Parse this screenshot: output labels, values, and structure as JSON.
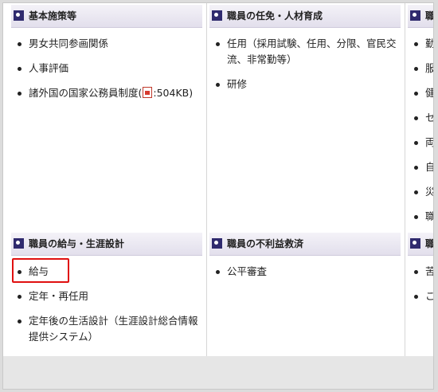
{
  "sections": {
    "basic": {
      "title": "基本施策等",
      "items": [
        "男女共同参画関係",
        "人事評価"
      ],
      "pdf_item": {
        "label": "諸外国の国家公務員制度(",
        "size": ":504KB)"
      }
    },
    "appointment": {
      "title": "職員の任免・人材育成",
      "items": [
        "任用（採用試験、任用、分限、官民交",
        "流、非常勤等）",
        "研修"
      ]
    },
    "right_top": {
      "title": "職",
      "items": [
        "勤",
        "服",
        "健",
        "セ",
        "両",
        "自",
        "災",
        "職"
      ]
    },
    "pay": {
      "title": "職員の給与・生涯設計",
      "items": [
        "給与",
        "定年・再任用",
        "定年後の生活設計（生涯設計総合情報",
        "提供システム）"
      ]
    },
    "grievance": {
      "title": "職員の不利益救済",
      "items": [
        "公平審査"
      ]
    },
    "right_bottom": {
      "title": "職",
      "items": [
        "苦",
        "こ"
      ]
    }
  },
  "icons": {
    "section_marker": "square-bullet-icon",
    "pdf": "pdf-icon"
  },
  "colors": {
    "marker": "#2f2a6e",
    "highlight": "#e01010",
    "header_bg": "#e2dfec"
  }
}
